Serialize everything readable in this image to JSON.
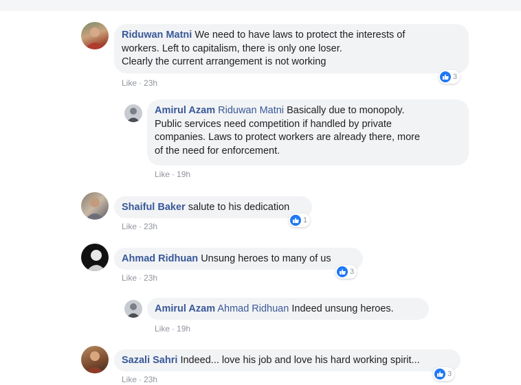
{
  "comments": [
    {
      "author": "Riduwan Matni",
      "text_lines": [
        "We need to have laws to protect the interests of",
        "workers. Left to capitalism, there is only one loser.",
        "Clearly the current arrangement is not working"
      ],
      "like_label": "Like",
      "time": "23h",
      "reaction_count": "3"
    },
    {
      "author": "Amirul Azam",
      "mention": "Riduwan Matni",
      "text_lines": [
        "Basically due to monopoly.",
        "Public services need competition if handled by private",
        "companies. Laws to protect workers are already there, more",
        "of the need for enforcement."
      ],
      "like_label": "Like",
      "time": "19h"
    },
    {
      "author": "Shaiful Baker",
      "text_lines": [
        "salute to his dedication"
      ],
      "like_label": "Like",
      "time": "23h",
      "reaction_count": "1"
    },
    {
      "author": "Ahmad Ridhuan",
      "text_lines": [
        "Unsung heroes to many of us"
      ],
      "like_label": "Like",
      "time": "23h",
      "reaction_count": "3"
    },
    {
      "author": "Amirul Azam",
      "mention": "Ahmad Ridhuan",
      "text_lines": [
        "Indeed unsung heroes."
      ],
      "like_label": "Like",
      "time": "19h"
    },
    {
      "author": "Sazali Sahri",
      "text_lines": [
        "Indeed... love his job and love his hard working spirit..."
      ],
      "like_label": "Like",
      "time": "23h",
      "reaction_count": "3"
    }
  ],
  "colors": {
    "author": "#385898",
    "bubble_bg": "#f2f3f5",
    "like_blue": "#2078f4",
    "meta": "#90949c"
  }
}
